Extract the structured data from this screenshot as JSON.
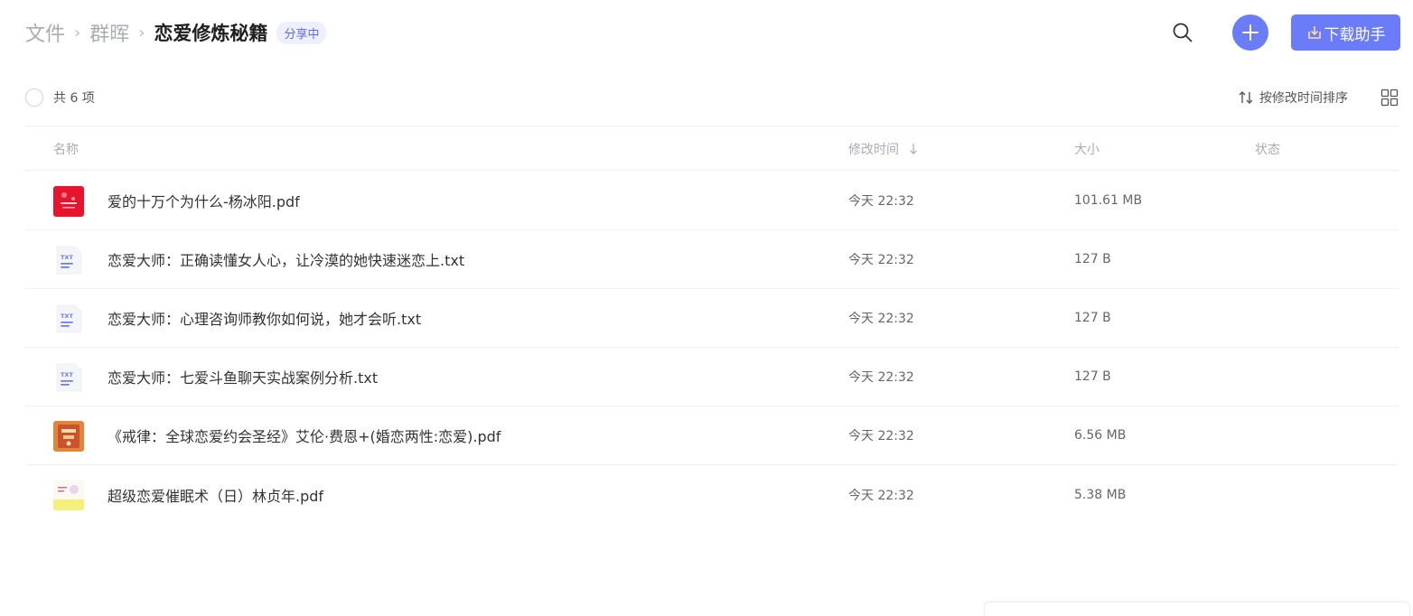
{
  "breadcrumb": {
    "items": [
      "文件",
      "群晖"
    ],
    "separator": "›",
    "current": "恋爱修炼秘籍",
    "badge": "分享中"
  },
  "header": {
    "search_icon": "search-icon",
    "add_icon": "plus-icon",
    "download_label": "下载助手",
    "accent_color": "#6a7cf7"
  },
  "toolbar": {
    "count_text": "共 6 项",
    "sort_label": "按修改时间排序",
    "view_icon": "grid-view-icon"
  },
  "table": {
    "columns": {
      "name": "名称",
      "modified": "修改时间",
      "size": "大小",
      "status": "状态"
    },
    "rows": [
      {
        "icon": "pdf-cover-red",
        "name": "爱的十万个为什么-杨冰阳.pdf",
        "modified": "今天 22:32",
        "size": "101.61 MB",
        "status": ""
      },
      {
        "icon": "txt-file",
        "name": "恋爱大师：正确读懂女人心，让冷漠的她快速迷恋上.txt",
        "modified": "今天 22:32",
        "size": "127 B",
        "status": ""
      },
      {
        "icon": "txt-file",
        "name": "恋爱大师：心理咨询师教你如何说，她才会听.txt",
        "modified": "今天 22:32",
        "size": "127 B",
        "status": ""
      },
      {
        "icon": "txt-file",
        "name": "恋爱大师：七爱斗鱼聊天实战案例分析.txt",
        "modified": "今天 22:32",
        "size": "127 B",
        "status": ""
      },
      {
        "icon": "pdf-cover-orange",
        "name": "《戒律：全球恋爱约会圣经》艾伦·费恩+(婚恋两性:恋爱).pdf",
        "modified": "今天 22:32",
        "size": "6.56 MB",
        "status": ""
      },
      {
        "icon": "pdf-cover-yellow",
        "name": "超级恋爱催眠术（日）林贞年.pdf",
        "modified": "今天 22:32",
        "size": "5.38 MB",
        "status": ""
      }
    ]
  }
}
